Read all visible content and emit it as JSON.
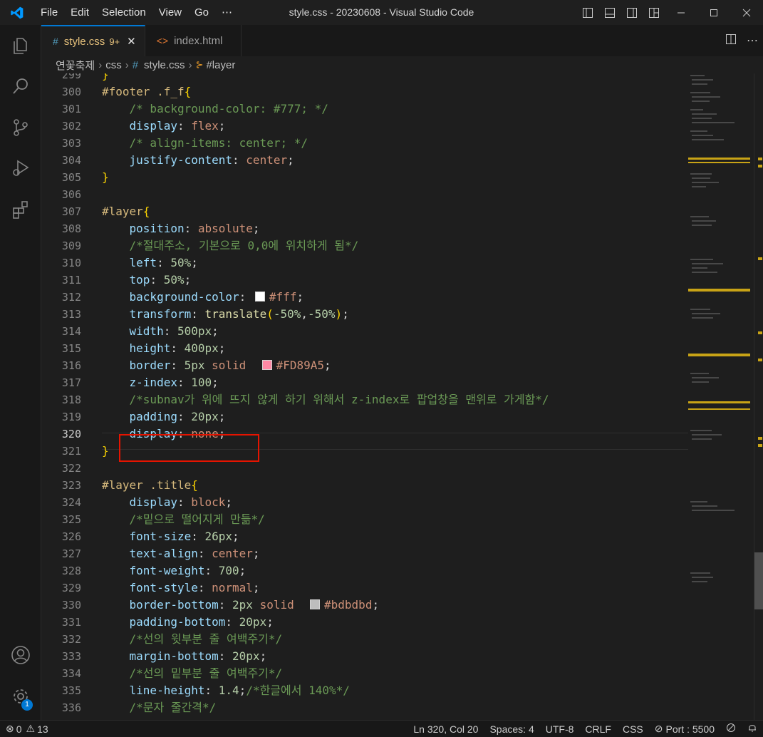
{
  "window": {
    "title": "style.css - 20230608 - Visual Studio Code"
  },
  "menu": [
    "File",
    "Edit",
    "Selection",
    "View",
    "Go",
    "⋯"
  ],
  "tabs": [
    {
      "label": "style.css",
      "badge": "9+",
      "icon": "css-file-icon",
      "active": true
    },
    {
      "label": "index.html",
      "icon": "html-file-icon",
      "active": false
    }
  ],
  "breadcrumb": [
    "연꽃축제",
    "css",
    "style.css",
    "#layer"
  ],
  "editor": {
    "current_line": 320,
    "lines": [
      {
        "n": 299,
        "t": [
          [
            "brace",
            "}"
          ]
        ]
      },
      {
        "n": 300,
        "t": [
          [
            "sel",
            "#footer .f_f"
          ],
          [
            "brace",
            "{"
          ]
        ]
      },
      {
        "n": 301,
        "t": [
          [
            "punc",
            "    "
          ],
          [
            "cmt",
            "/* background-color: #777; */"
          ]
        ]
      },
      {
        "n": 302,
        "t": [
          [
            "punc",
            "    "
          ],
          [
            "prop",
            "display"
          ],
          [
            "punc",
            ": "
          ],
          [
            "val",
            "flex"
          ],
          [
            "punc",
            ";"
          ]
        ]
      },
      {
        "n": 303,
        "t": [
          [
            "punc",
            "    "
          ],
          [
            "cmt",
            "/* align-items: center; */"
          ]
        ]
      },
      {
        "n": 304,
        "t": [
          [
            "punc",
            "    "
          ],
          [
            "prop",
            "justify-content"
          ],
          [
            "punc",
            ": "
          ],
          [
            "val",
            "center"
          ],
          [
            "punc",
            ";"
          ]
        ]
      },
      {
        "n": 305,
        "t": [
          [
            "brace",
            "}"
          ]
        ]
      },
      {
        "n": 306,
        "t": []
      },
      {
        "n": 307,
        "t": [
          [
            "sel",
            "#layer"
          ],
          [
            "brace",
            "{"
          ]
        ]
      },
      {
        "n": 308,
        "t": [
          [
            "punc",
            "    "
          ],
          [
            "prop",
            "position"
          ],
          [
            "punc",
            ": "
          ],
          [
            "val",
            "absolute"
          ],
          [
            "punc",
            ";"
          ]
        ]
      },
      {
        "n": 309,
        "t": [
          [
            "punc",
            "    "
          ],
          [
            "cmt",
            "/*절대주소, 기본으로 0,0에 위치하게 됨*/"
          ]
        ]
      },
      {
        "n": 310,
        "t": [
          [
            "punc",
            "    "
          ],
          [
            "prop",
            "left"
          ],
          [
            "punc",
            ": "
          ],
          [
            "num",
            "50%"
          ],
          [
            "punc",
            ";"
          ]
        ]
      },
      {
        "n": 311,
        "t": [
          [
            "punc",
            "    "
          ],
          [
            "prop",
            "top"
          ],
          [
            "punc",
            ": "
          ],
          [
            "num",
            "50%"
          ],
          [
            "punc",
            ";"
          ]
        ]
      },
      {
        "n": 312,
        "t": [
          [
            "punc",
            "    "
          ],
          [
            "prop",
            "background-color"
          ],
          [
            "punc",
            ": "
          ],
          [
            "swatch",
            "#ffffff"
          ],
          [
            "val",
            "#fff"
          ],
          [
            "punc",
            ";"
          ]
        ]
      },
      {
        "n": 313,
        "t": [
          [
            "punc",
            "    "
          ],
          [
            "prop",
            "transform"
          ],
          [
            "punc",
            ": "
          ],
          [
            "fn",
            "translate"
          ],
          [
            "brace",
            "("
          ],
          [
            "num",
            "-50%"
          ],
          [
            "punc",
            ","
          ],
          [
            "num",
            "-50%"
          ],
          [
            "brace",
            ")"
          ],
          [
            "punc",
            ";"
          ]
        ]
      },
      {
        "n": 314,
        "t": [
          [
            "punc",
            "    "
          ],
          [
            "prop",
            "width"
          ],
          [
            "punc",
            ": "
          ],
          [
            "num",
            "500px"
          ],
          [
            "punc",
            ";"
          ]
        ]
      },
      {
        "n": 315,
        "t": [
          [
            "punc",
            "    "
          ],
          [
            "prop",
            "height"
          ],
          [
            "punc",
            ": "
          ],
          [
            "num",
            "400px"
          ],
          [
            "punc",
            ";"
          ]
        ]
      },
      {
        "n": 316,
        "t": [
          [
            "punc",
            "    "
          ],
          [
            "prop",
            "border"
          ],
          [
            "punc",
            ": "
          ],
          [
            "num",
            "5px"
          ],
          [
            "punc",
            " "
          ],
          [
            "val",
            "solid"
          ],
          [
            "punc",
            "  "
          ],
          [
            "swatch",
            "#FD89A5"
          ],
          [
            "val",
            "#FD89A5"
          ],
          [
            "punc",
            ";"
          ]
        ]
      },
      {
        "n": 317,
        "t": [
          [
            "punc",
            "    "
          ],
          [
            "prop",
            "z-index"
          ],
          [
            "punc",
            ": "
          ],
          [
            "num",
            "100"
          ],
          [
            "punc",
            ";"
          ]
        ]
      },
      {
        "n": 318,
        "t": [
          [
            "punc",
            "    "
          ],
          [
            "cmt",
            "/*subnav가 위에 뜨지 않게 하기 위해서 z-index로 팝업창을 맨위로 가게함*/"
          ]
        ]
      },
      {
        "n": 319,
        "t": [
          [
            "punc",
            "    "
          ],
          [
            "prop",
            "padding"
          ],
          [
            "punc",
            ": "
          ],
          [
            "num",
            "20px"
          ],
          [
            "punc",
            ";"
          ]
        ]
      },
      {
        "n": 320,
        "t": [
          [
            "punc",
            "    "
          ],
          [
            "prop",
            "display"
          ],
          [
            "punc",
            ": "
          ],
          [
            "val",
            "none"
          ],
          [
            "punc",
            ";"
          ]
        ]
      },
      {
        "n": 321,
        "t": [
          [
            "brace",
            "}"
          ]
        ]
      },
      {
        "n": 322,
        "t": []
      },
      {
        "n": 323,
        "t": [
          [
            "sel",
            "#layer .title"
          ],
          [
            "brace",
            "{"
          ]
        ]
      },
      {
        "n": 324,
        "t": [
          [
            "punc",
            "    "
          ],
          [
            "prop",
            "display"
          ],
          [
            "punc",
            ": "
          ],
          [
            "val",
            "block"
          ],
          [
            "punc",
            ";"
          ]
        ]
      },
      {
        "n": 325,
        "t": [
          [
            "punc",
            "    "
          ],
          [
            "cmt",
            "/*밑으로 떨어지게 만듦*/"
          ]
        ]
      },
      {
        "n": 326,
        "t": [
          [
            "punc",
            "    "
          ],
          [
            "prop",
            "font-size"
          ],
          [
            "punc",
            ": "
          ],
          [
            "num",
            "26px"
          ],
          [
            "punc",
            ";"
          ]
        ]
      },
      {
        "n": 327,
        "t": [
          [
            "punc",
            "    "
          ],
          [
            "prop",
            "text-align"
          ],
          [
            "punc",
            ": "
          ],
          [
            "val",
            "center"
          ],
          [
            "punc",
            ";"
          ]
        ]
      },
      {
        "n": 328,
        "t": [
          [
            "punc",
            "    "
          ],
          [
            "prop",
            "font-weight"
          ],
          [
            "punc",
            ": "
          ],
          [
            "num",
            "700"
          ],
          [
            "punc",
            ";"
          ]
        ]
      },
      {
        "n": 329,
        "t": [
          [
            "punc",
            "    "
          ],
          [
            "prop",
            "font-style"
          ],
          [
            "punc",
            ": "
          ],
          [
            "val",
            "normal"
          ],
          [
            "punc",
            ";"
          ]
        ]
      },
      {
        "n": 330,
        "t": [
          [
            "punc",
            "    "
          ],
          [
            "prop",
            "border-bottom"
          ],
          [
            "punc",
            ": "
          ],
          [
            "num",
            "2px"
          ],
          [
            "punc",
            " "
          ],
          [
            "val",
            "solid"
          ],
          [
            "punc",
            "  "
          ],
          [
            "swatch",
            "#bdbdbd"
          ],
          [
            "val",
            "#bdbdbd"
          ],
          [
            "punc",
            ";"
          ]
        ]
      },
      {
        "n": 331,
        "t": [
          [
            "punc",
            "    "
          ],
          [
            "prop",
            "padding-bottom"
          ],
          [
            "punc",
            ": "
          ],
          [
            "num",
            "20px"
          ],
          [
            "punc",
            ";"
          ]
        ]
      },
      {
        "n": 332,
        "t": [
          [
            "punc",
            "    "
          ],
          [
            "cmt",
            "/*선의 윗부분 줄 여백주기*/"
          ]
        ]
      },
      {
        "n": 333,
        "t": [
          [
            "punc",
            "    "
          ],
          [
            "prop",
            "margin-bottom"
          ],
          [
            "punc",
            ": "
          ],
          [
            "num",
            "20px"
          ],
          [
            "punc",
            ";"
          ]
        ]
      },
      {
        "n": 334,
        "t": [
          [
            "punc",
            "    "
          ],
          [
            "cmt",
            "/*선의 밑부분 줄 여백주기*/"
          ]
        ]
      },
      {
        "n": 335,
        "t": [
          [
            "punc",
            "    "
          ],
          [
            "prop",
            "line-height"
          ],
          [
            "punc",
            ": "
          ],
          [
            "num",
            "1.4"
          ],
          [
            "punc",
            ";"
          ],
          [
            "cmt",
            "/*한글에서 140%*/"
          ]
        ]
      },
      {
        "n": 336,
        "t": [
          [
            "punc",
            "    "
          ],
          [
            "cmt",
            "/*문자 줄간격*/"
          ]
        ]
      }
    ]
  },
  "activity_badge": "1",
  "status": {
    "errors": "0",
    "warnings": "13",
    "position": "Ln 320, Col 20",
    "spaces": "Spaces: 4",
    "encoding": "UTF-8",
    "eol": "CRLF",
    "language": "CSS",
    "port": "Port : 5500"
  },
  "colors": {
    "accent": "#0078d4",
    "highlight_box": "#e51400"
  }
}
